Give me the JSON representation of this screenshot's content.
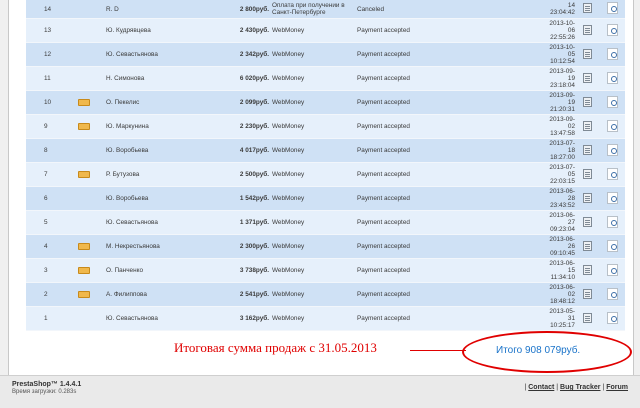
{
  "orders": [
    {
      "id": "14",
      "is_new": false,
      "customer": "R. D",
      "total": "2 800руб.",
      "payment": "Оплата при получении в Санкт-Петербурге",
      "status": "Canceled",
      "date_line1": "",
      "date_line2": "14",
      "date_line3": "23:04:42"
    },
    {
      "id": "13",
      "is_new": false,
      "customer": "Ю. Кудрявцева",
      "total": "2 430руб.",
      "payment": "WebMoney",
      "status": "Payment accepted",
      "date_line1": "2013-10-",
      "date_line2": "06",
      "date_line3": "22:55:26"
    },
    {
      "id": "12",
      "is_new": false,
      "customer": "Ю. Севастьянова",
      "total": "2 342руб.",
      "payment": "WebMoney",
      "status": "Payment accepted",
      "date_line1": "2013-10-",
      "date_line2": "05",
      "date_line3": "10:12:54"
    },
    {
      "id": "11",
      "is_new": false,
      "customer": "Н. Симонова",
      "total": "6 020руб.",
      "payment": "WebMoney",
      "status": "Payment accepted",
      "date_line1": "2013-09-",
      "date_line2": "19",
      "date_line3": "23:18:04"
    },
    {
      "id": "10",
      "is_new": true,
      "customer": "О. Пекелис",
      "total": "2 099руб.",
      "payment": "WebMoney",
      "status": "Payment accepted",
      "date_line1": "2013-09-",
      "date_line2": "19",
      "date_line3": "21:20:31"
    },
    {
      "id": "9",
      "is_new": true,
      "customer": "Ю. Маркунина",
      "total": "2 230руб.",
      "payment": "WebMoney",
      "status": "Payment accepted",
      "date_line1": "2013-09-",
      "date_line2": "02",
      "date_line3": "13:47:58"
    },
    {
      "id": "8",
      "is_new": false,
      "customer": "Ю. Воробьева",
      "total": "4 017руб.",
      "payment": "WebMoney",
      "status": "Payment accepted",
      "date_line1": "2013-07-",
      "date_line2": "18",
      "date_line3": "18:27:00"
    },
    {
      "id": "7",
      "is_new": true,
      "customer": "Р. Бутузова",
      "total": "2 500руб.",
      "payment": "WebMoney",
      "status": "Payment accepted",
      "date_line1": "2013-07-",
      "date_line2": "05",
      "date_line3": "22:03:15"
    },
    {
      "id": "6",
      "is_new": false,
      "customer": "Ю. Воробьева",
      "total": "1 542руб.",
      "payment": "WebMoney",
      "status": "Payment accepted",
      "date_line1": "2013-06-",
      "date_line2": "28",
      "date_line3": "23:43:52"
    },
    {
      "id": "5",
      "is_new": false,
      "customer": "Ю. Севастьянова",
      "total": "1 371руб.",
      "payment": "WebMoney",
      "status": "Payment accepted",
      "date_line1": "2013-06-",
      "date_line2": "27",
      "date_line3": "09:23:04"
    },
    {
      "id": "4",
      "is_new": true,
      "customer": "М. Некрестьянова",
      "total": "2 300руб.",
      "payment": "WebMoney",
      "status": "Payment accepted",
      "date_line1": "2013-06-",
      "date_line2": "26",
      "date_line3": "09:10:45"
    },
    {
      "id": "3",
      "is_new": true,
      "customer": "О. Панченко",
      "total": "3 738руб.",
      "payment": "WebMoney",
      "status": "Payment accepted",
      "date_line1": "2013-06-",
      "date_line2": "15",
      "date_line3": "11:34:10"
    },
    {
      "id": "2",
      "is_new": true,
      "customer": "А. Филиппова",
      "total": "2 541руб.",
      "payment": "WebMoney",
      "status": "Payment accepted",
      "date_line1": "2013-06-",
      "date_line2": "02",
      "date_line3": "18:48:12"
    },
    {
      "id": "1",
      "is_new": false,
      "customer": "Ю. Севастьянова",
      "total": "3 162руб.",
      "payment": "WebMoney",
      "status": "Payment accepted",
      "date_line1": "2013-05-",
      "date_line2": "31",
      "date_line3": "10:25:17"
    }
  ],
  "annotation": {
    "text": "Итоговая сумма продаж с 31.05.2013",
    "color": "#e00000"
  },
  "total_label": "Итого 908 079руб.",
  "footer": {
    "brand": "PrestaShop™ 1.4.4.1",
    "load_time": "Время загрузки: 0.283s",
    "links": [
      "Contact",
      "Bug Tracker",
      "Forum"
    ]
  },
  "colors": {
    "row_dark": "#cfe1f5",
    "row_light": "#e6f0fb",
    "total_text": "#1a73c9"
  },
  "icons": {
    "new_customer": "new-customer-icon",
    "invoice": "invoice-icon",
    "view": "view-details-icon"
  }
}
